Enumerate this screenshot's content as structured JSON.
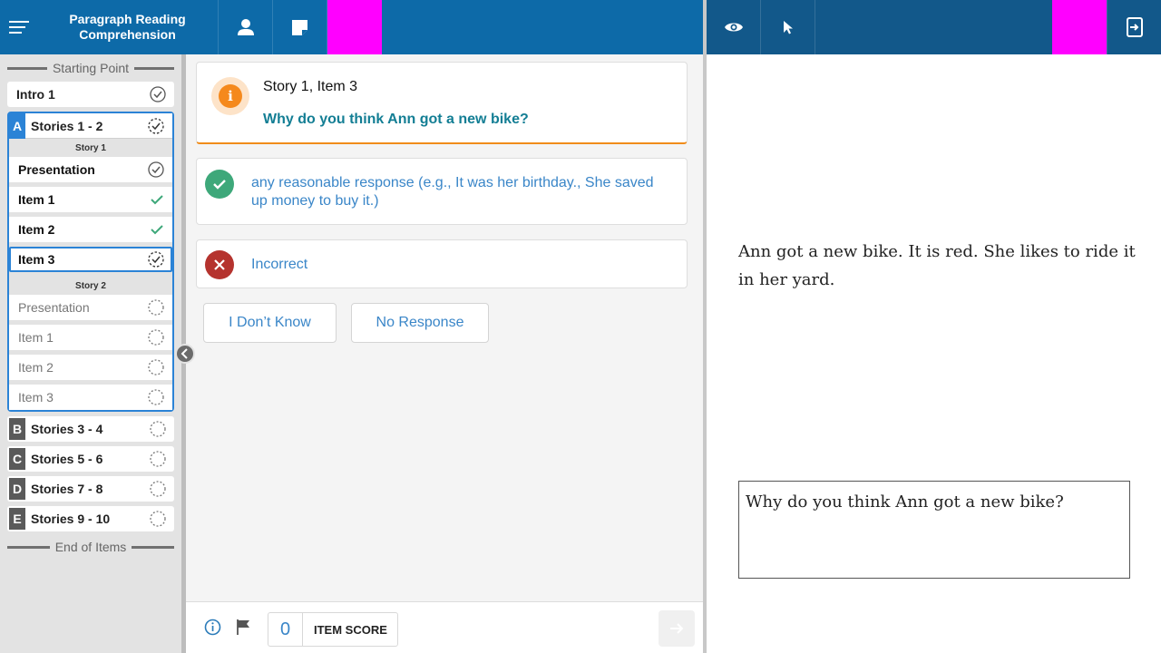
{
  "app": {
    "title": "Paragraph Reading Comprehension",
    "left_toolbar": {
      "menu_icon": "hamburger-menu-icon",
      "student_icon": "person-icon",
      "notes_icon": "note-icon",
      "highlight_color": "#ff00ff"
    },
    "right_toolbar": {
      "view_icon": "eye-icon",
      "pointer_icon": "cursor-icon",
      "exit_icon": "device-exit-icon",
      "highlight_color": "#ff00ff"
    }
  },
  "sidebar": {
    "start_label": "Starting Point",
    "end_label": "End of Items",
    "intro": {
      "label": "Intro 1",
      "status": "complete"
    },
    "groups": [
      {
        "letter": "A",
        "label": "Stories 1 - 2",
        "status": "in-progress",
        "expanded": true,
        "stories": [
          {
            "heading": "Story 1",
            "items": [
              {
                "label": "Presentation",
                "status": "complete"
              },
              {
                "label": "Item 1",
                "status": "correct"
              },
              {
                "label": "Item 2",
                "status": "correct"
              },
              {
                "label": "Item 3",
                "status": "in-progress",
                "current": true
              }
            ]
          },
          {
            "heading": "Story 2",
            "items": [
              {
                "label": "Presentation",
                "status": "not-started"
              },
              {
                "label": "Item 1",
                "status": "not-started"
              },
              {
                "label": "Item 2",
                "status": "not-started"
              },
              {
                "label": "Item 3",
                "status": "not-started"
              }
            ]
          }
        ]
      },
      {
        "letter": "B",
        "label": "Stories 3 - 4",
        "status": "not-started"
      },
      {
        "letter": "C",
        "label": "Stories 5 - 6",
        "status": "not-started"
      },
      {
        "letter": "D",
        "label": "Stories 7 - 8",
        "status": "not-started"
      },
      {
        "letter": "E",
        "label": "Stories 9 - 10",
        "status": "not-started"
      }
    ]
  },
  "question": {
    "label": "Story 1, Item 3",
    "text": "Why do you think Ann got a new bike?",
    "icon": "info-icon"
  },
  "responses": {
    "correct": "any reasonable response (e.g., It was her birthday., She saved up money to buy it.)",
    "incorrect": "Incorrect",
    "dont_know": "I Don’t Know",
    "no_response": "No Response"
  },
  "footer": {
    "score_value": "0",
    "score_label": "ITEM SCORE",
    "info_icon": "info-circle-icon",
    "flag_icon": "flag-icon",
    "next_icon": "arrow-right-icon"
  },
  "student_view": {
    "story": "Ann got a new bike. It is red. She likes to ride it in her yard.",
    "question": "Why do you think Ann got a new bike?"
  },
  "colors": {
    "primary": "#0d6aa8",
    "secondary": "#12588a",
    "accent_blue": "#2b83d6",
    "question_teal": "#137e94",
    "correct_green": "#3ea87a",
    "incorrect_red": "#b5332e",
    "info_orange": "#f5891c"
  }
}
